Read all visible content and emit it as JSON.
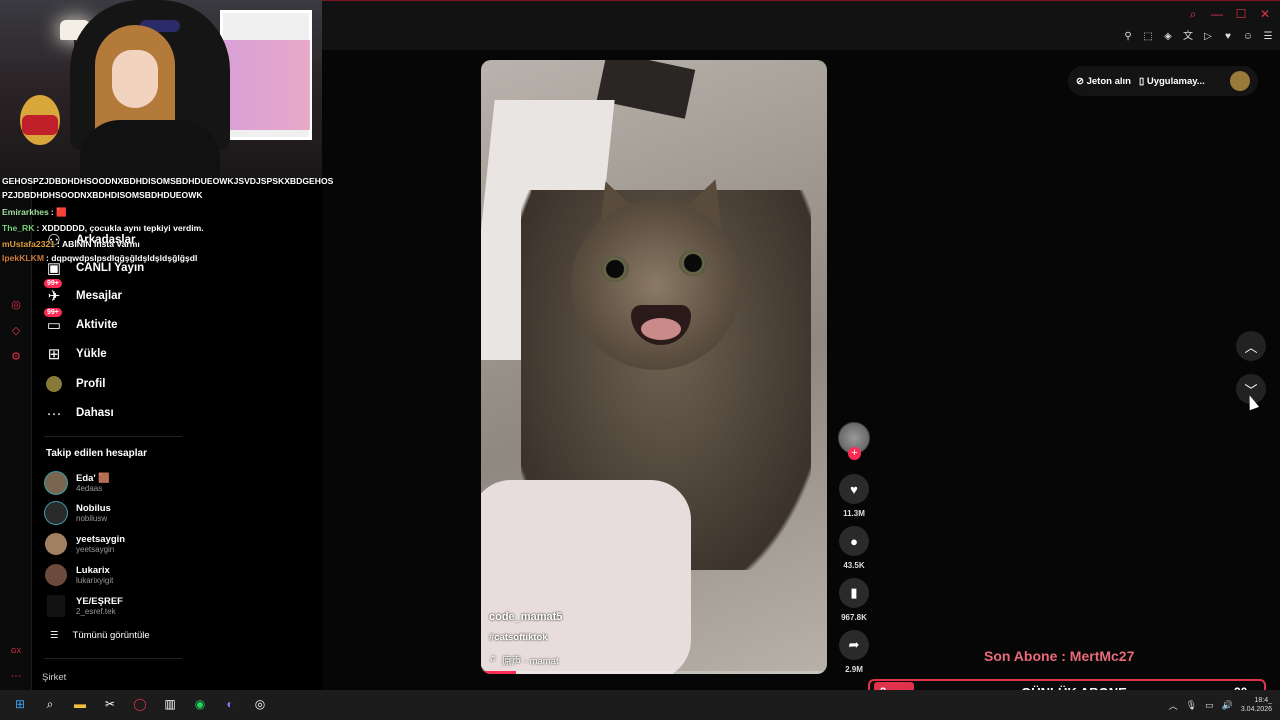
{
  "sidebar": {
    "nav": [
      {
        "label": "Arkadaşlar",
        "icon": "friends-icon"
      },
      {
        "label": "CANLI Yayın",
        "icon": "live-icon"
      },
      {
        "label": "Mesajlar",
        "icon": "message-icon",
        "badge": "99+"
      },
      {
        "label": "Aktivite",
        "icon": "activity-icon",
        "badge": "99+"
      },
      {
        "label": "Yükle",
        "icon": "upload-icon"
      },
      {
        "label": "Profil",
        "icon": "profile-icon"
      },
      {
        "label": "Dahası",
        "icon": "more-icon"
      }
    ],
    "following_title": "Takip edilen hesaplar",
    "following": [
      {
        "name": "Eda' 🟫",
        "handle": "4edaas"
      },
      {
        "name": "Nobilus",
        "handle": "nobilusw"
      },
      {
        "name": "yeetsaygin",
        "handle": "yeetsaygin"
      },
      {
        "name": "Lukarix",
        "handle": "lukarixyigit"
      },
      {
        "name": "YE/EŞREF",
        "handle": "2_esref.tek"
      }
    ],
    "view_all": "Tümünü görüntüle",
    "company": "Şirket"
  },
  "chat": [
    {
      "user": "",
      "text": "GEHOSPZJDBDHDHSOODNXBDHDISOMSBDHDUEOWKJSVDJSPSKXBDGEHOS",
      "color": "#ffffff"
    },
    {
      "user": "",
      "text": "PZJDBDHDHSOODNXBDHDISOMSBDHDUEOWK",
      "color": "#ffffff"
    },
    {
      "user": "Emirarkhes",
      "text": ": 🟥",
      "color": "#9ee0a0"
    },
    {
      "user": "The_RK",
      "text": ": XDDDDDD, çocukla aynı tepkiyi verdim.",
      "color": "#7ad37a"
    },
    {
      "user": "mUstafa2321",
      "text": ": ABİNİN İnsta Varmı",
      "color": "#e0a040"
    },
    {
      "user": "IpekKLKM",
      "text": ": dqpqwdpslpsdlqğşğldşldşldşğlğşdl",
      "color": "#d07a3a"
    }
  ],
  "video": {
    "author": "code_mamat5",
    "hashtag": "#catsoftiktok",
    "music": "原声 - mamat",
    "progress": 0.1
  },
  "actions": {
    "likes": "11.3M",
    "comments": "43.5K",
    "saves": "967.8K",
    "shares": "2.9M"
  },
  "header": {
    "coins": "Jeton alın",
    "app": "Uygulamay..."
  },
  "overlay": {
    "last_sub_label": "Son Abone : MertMc27",
    "daily_title": "GÜNLÜK ABONE",
    "daily_left": "2",
    "daily_right": "20"
  },
  "taskbar": {
    "time": "18:4_",
    "date": "3.04.2026"
  },
  "colors": {
    "accent": "#fe2c55",
    "overlay_red": "#e0324a"
  }
}
